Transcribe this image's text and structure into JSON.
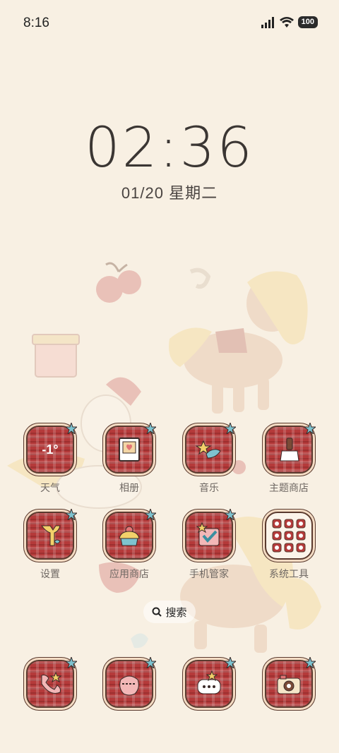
{
  "status": {
    "time": "8:16",
    "battery": "100"
  },
  "clock": {
    "time": "02:36",
    "date": "01/20 星期二"
  },
  "apps_row1": [
    {
      "label": "天气",
      "icon": "weather-icon",
      "text": "-1°"
    },
    {
      "label": "相册",
      "icon": "photo-frame-icon"
    },
    {
      "label": "音乐",
      "icon": "music-fish-icon"
    },
    {
      "label": "主题商店",
      "icon": "paint-brush-icon"
    }
  ],
  "apps_row2": [
    {
      "label": "设置",
      "icon": "wrench-icon"
    },
    {
      "label": "应用商店",
      "icon": "cupcake-icon"
    },
    {
      "label": "手机管家",
      "icon": "shield-check-icon"
    },
    {
      "label": "系统工具",
      "icon": "grid-folder-icon"
    }
  ],
  "search": {
    "label": "搜索"
  },
  "dock": [
    {
      "icon": "phone-icon"
    },
    {
      "icon": "apple-icon"
    },
    {
      "icon": "message-icon"
    },
    {
      "icon": "camera-icon"
    }
  ],
  "colors": {
    "background": "#f8f0e3",
    "tile": "#b53a3a",
    "outline": "#5a3a2e"
  }
}
